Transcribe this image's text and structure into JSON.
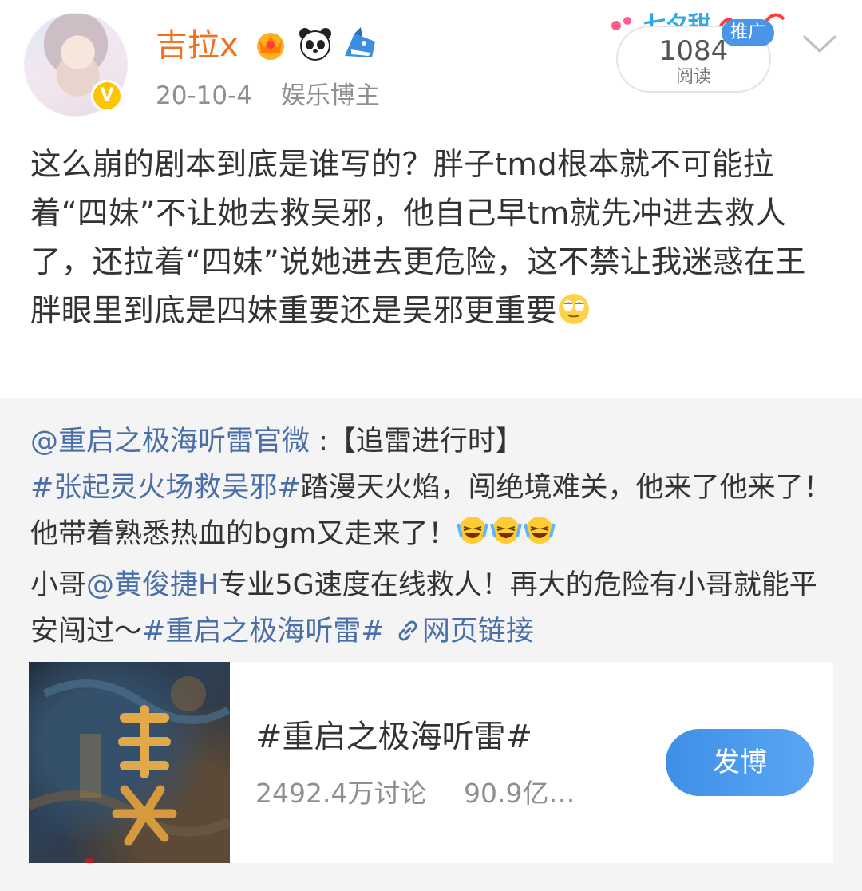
{
  "user": {
    "name": "吉拉x",
    "date": "20-10-4",
    "identity": "娱乐博主",
    "verified_glyph": "V",
    "badges": [
      "crown-badge",
      "panda-badge",
      "shark-badge"
    ]
  },
  "read_counter": {
    "count": "1084",
    "label": "阅读"
  },
  "promo_tag": "推广",
  "post": {
    "text": "这么崩的剧本到底是谁写的？胖子tmd根本就不可能拉着“四妹”不让她去救吴邪，他自己早tm就先冲进去救人了，还拉着“四妹”说她进去更危险，这不禁让我迷惑在王胖眼里到底是四妹重要还是吴邪更重要",
    "emoji": "rolling-eyes-emoji"
  },
  "repost": {
    "author": "@重启之极海听雷官微",
    "p1": " :【追雷进行时】",
    "hashtag1": "#张起灵火场救吴邪#",
    "p2": "踏漫天火焰，闯绝境难关，他来了他来了！他带着熟悉热血的bgm又走来了！",
    "p3": "小哥",
    "mention": "@黄俊捷H",
    "p4": "专业5G速度在线救人！再大的危险有小哥就能平安闯过～",
    "hashtag2": "#重启之极海听雷#",
    "link_icon": "link-icon",
    "link_text": "网页链接"
  },
  "topic_card": {
    "title": "#重启之极海听雷#",
    "discussions": "2492.4万讨论",
    "reads": "90.9亿…",
    "button": "发博"
  },
  "colors": {
    "username": "#f2701e",
    "link": "#4a6ea8",
    "button": "#4a95e8",
    "repost_bg": "#f4f4f4"
  }
}
